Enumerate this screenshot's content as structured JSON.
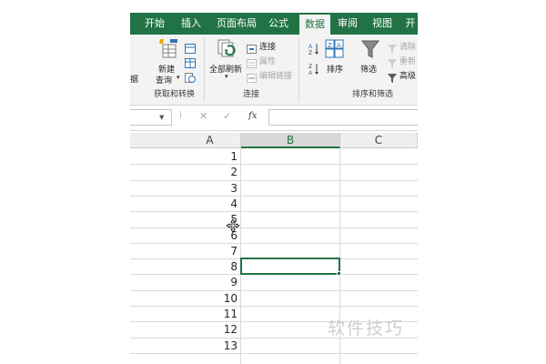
{
  "ribbon": {
    "tabs": [
      {
        "label": "开始"
      },
      {
        "label": "插入"
      },
      {
        "label": "页面布局"
      },
      {
        "label": "公式"
      },
      {
        "label": "数据",
        "active": true
      },
      {
        "label": "审阅"
      },
      {
        "label": "视图"
      },
      {
        "label": "开"
      }
    ],
    "groups": {
      "get_transform": {
        "label": "获取和转换",
        "cut_label": "据",
        "new_query_line1": "新建",
        "new_query_line2": "查询"
      },
      "connections": {
        "label": "连接",
        "refresh_all": "全部刷新",
        "connections": "连接",
        "properties": "属性",
        "edit_links": "编辑链接"
      },
      "sort_filter": {
        "label": "排序和筛选",
        "sort": "排序",
        "filter": "筛选",
        "clear": "清除",
        "reapply": "重新",
        "advanced": "高级"
      }
    }
  },
  "formula_bar": {
    "cancel": "✕",
    "enter": "✓",
    "fx": "fx",
    "value": ""
  },
  "sheet": {
    "columns": [
      "A",
      "B",
      "C"
    ],
    "selected_column": "B",
    "rows": [
      {
        "a": "1"
      },
      {
        "a": "2"
      },
      {
        "a": "3"
      },
      {
        "a": "4"
      },
      {
        "a": "5"
      },
      {
        "a": "6"
      },
      {
        "a": "7"
      },
      {
        "a": "8"
      },
      {
        "a": "9"
      },
      {
        "a": "10"
      },
      {
        "a": "11"
      },
      {
        "a": "12"
      },
      {
        "a": "13"
      }
    ],
    "active_cell": "B8"
  },
  "watermark": "软件技巧",
  "colors": {
    "accent": "#217346",
    "ribbon_bg": "#f3f3f3",
    "grid_line": "#dadada"
  }
}
